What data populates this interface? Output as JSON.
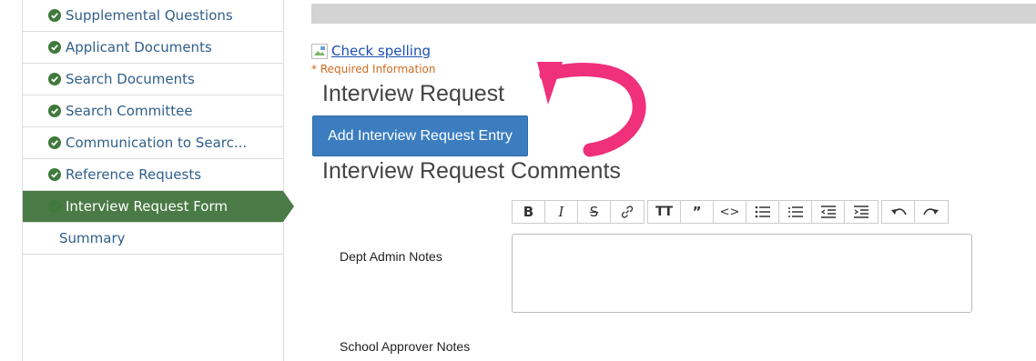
{
  "sidebar": {
    "items": [
      {
        "label": "Supplemental Questions",
        "status": "complete"
      },
      {
        "label": "Applicant Documents",
        "status": "complete"
      },
      {
        "label": "Search Documents",
        "status": "complete"
      },
      {
        "label": "Search Committee",
        "status": "complete"
      },
      {
        "label": "Communication to Searc...",
        "status": "complete"
      },
      {
        "label": "Reference Requests",
        "status": "complete"
      },
      {
        "label": "Interview Request Form",
        "status": "active"
      },
      {
        "label": "Summary",
        "status": "none"
      }
    ],
    "colors": {
      "link": "#2f5f8a",
      "check": "#3f7a3c",
      "active_bg": "#4a7a46"
    }
  },
  "main": {
    "spellcheck_label": "Check spelling",
    "required_note": "* Required Information",
    "interview_request_heading": "Interview Request",
    "add_entry_button": "Add Interview Request Entry",
    "comments_heading": "Interview Request Comments",
    "toolbar": {
      "groups": [
        [
          "bold",
          "italic",
          "strikethrough",
          "link"
        ],
        [
          "heading",
          "blockquote",
          "code",
          "bullet-list",
          "numbered-list",
          "outdent",
          "indent"
        ],
        [
          "undo",
          "redo"
        ]
      ]
    },
    "fields": [
      {
        "label": "Dept Admin Notes",
        "value": ""
      },
      {
        "label": "School Approver Notes",
        "value": ""
      }
    ]
  },
  "annotation": {
    "type": "curved-arrow",
    "color": "#f0307a"
  }
}
